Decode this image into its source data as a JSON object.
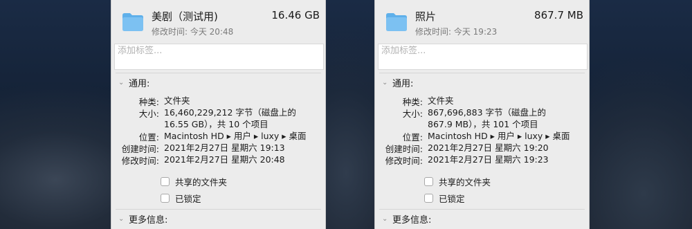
{
  "colors": {
    "folder_body": "#7cc1f2",
    "folder_tab": "#5fb0ea",
    "panel_bg": "#ececec"
  },
  "panels": [
    {
      "name": "美剧（测试用)",
      "size": "16.46 GB",
      "modified_line": "修改时间:  今天 20:48",
      "tags_placeholder": "添加标签...",
      "general_title": "通用:",
      "kind_label": "种类:",
      "kind_value": "文件夹",
      "size_label": "大小:",
      "size_value": "16,460,229,212 字节（磁盘上的\n16.55 GB），共 10 个项目",
      "where_label": "位置:",
      "where_value": "Macintosh HD ▸ 用户 ▸ luxy ▸ 桌面",
      "created_label": "创建时间:",
      "created_value": "2021年2月27日 星期六 19:13",
      "modified_label": "修改时间:",
      "modified_value": "2021年2月27日 星期六 20:48",
      "shared_label": "共享的文件夹",
      "locked_label": "已锁定",
      "more_title": "更多信息:"
    },
    {
      "name": "照片",
      "size": "867.7 MB",
      "modified_line": "修改时间:  今天 19:23",
      "tags_placeholder": "添加标签...",
      "general_title": "通用:",
      "kind_label": "种类:",
      "kind_value": "文件夹",
      "size_label": "大小:",
      "size_value": "867,696,883 字节（磁盘上的\n867.9 MB），共 101 个项目",
      "where_label": "位置:",
      "where_value": "Macintosh HD ▸ 用户 ▸ luxy ▸ 桌面",
      "created_label": "创建时间:",
      "created_value": "2021年2月27日 星期六 19:20",
      "modified_label": "修改时间:",
      "modified_value": "2021年2月27日 星期六 19:23",
      "shared_label": "共享的文件夹",
      "locked_label": "已锁定",
      "more_title": "更多信息:"
    }
  ]
}
